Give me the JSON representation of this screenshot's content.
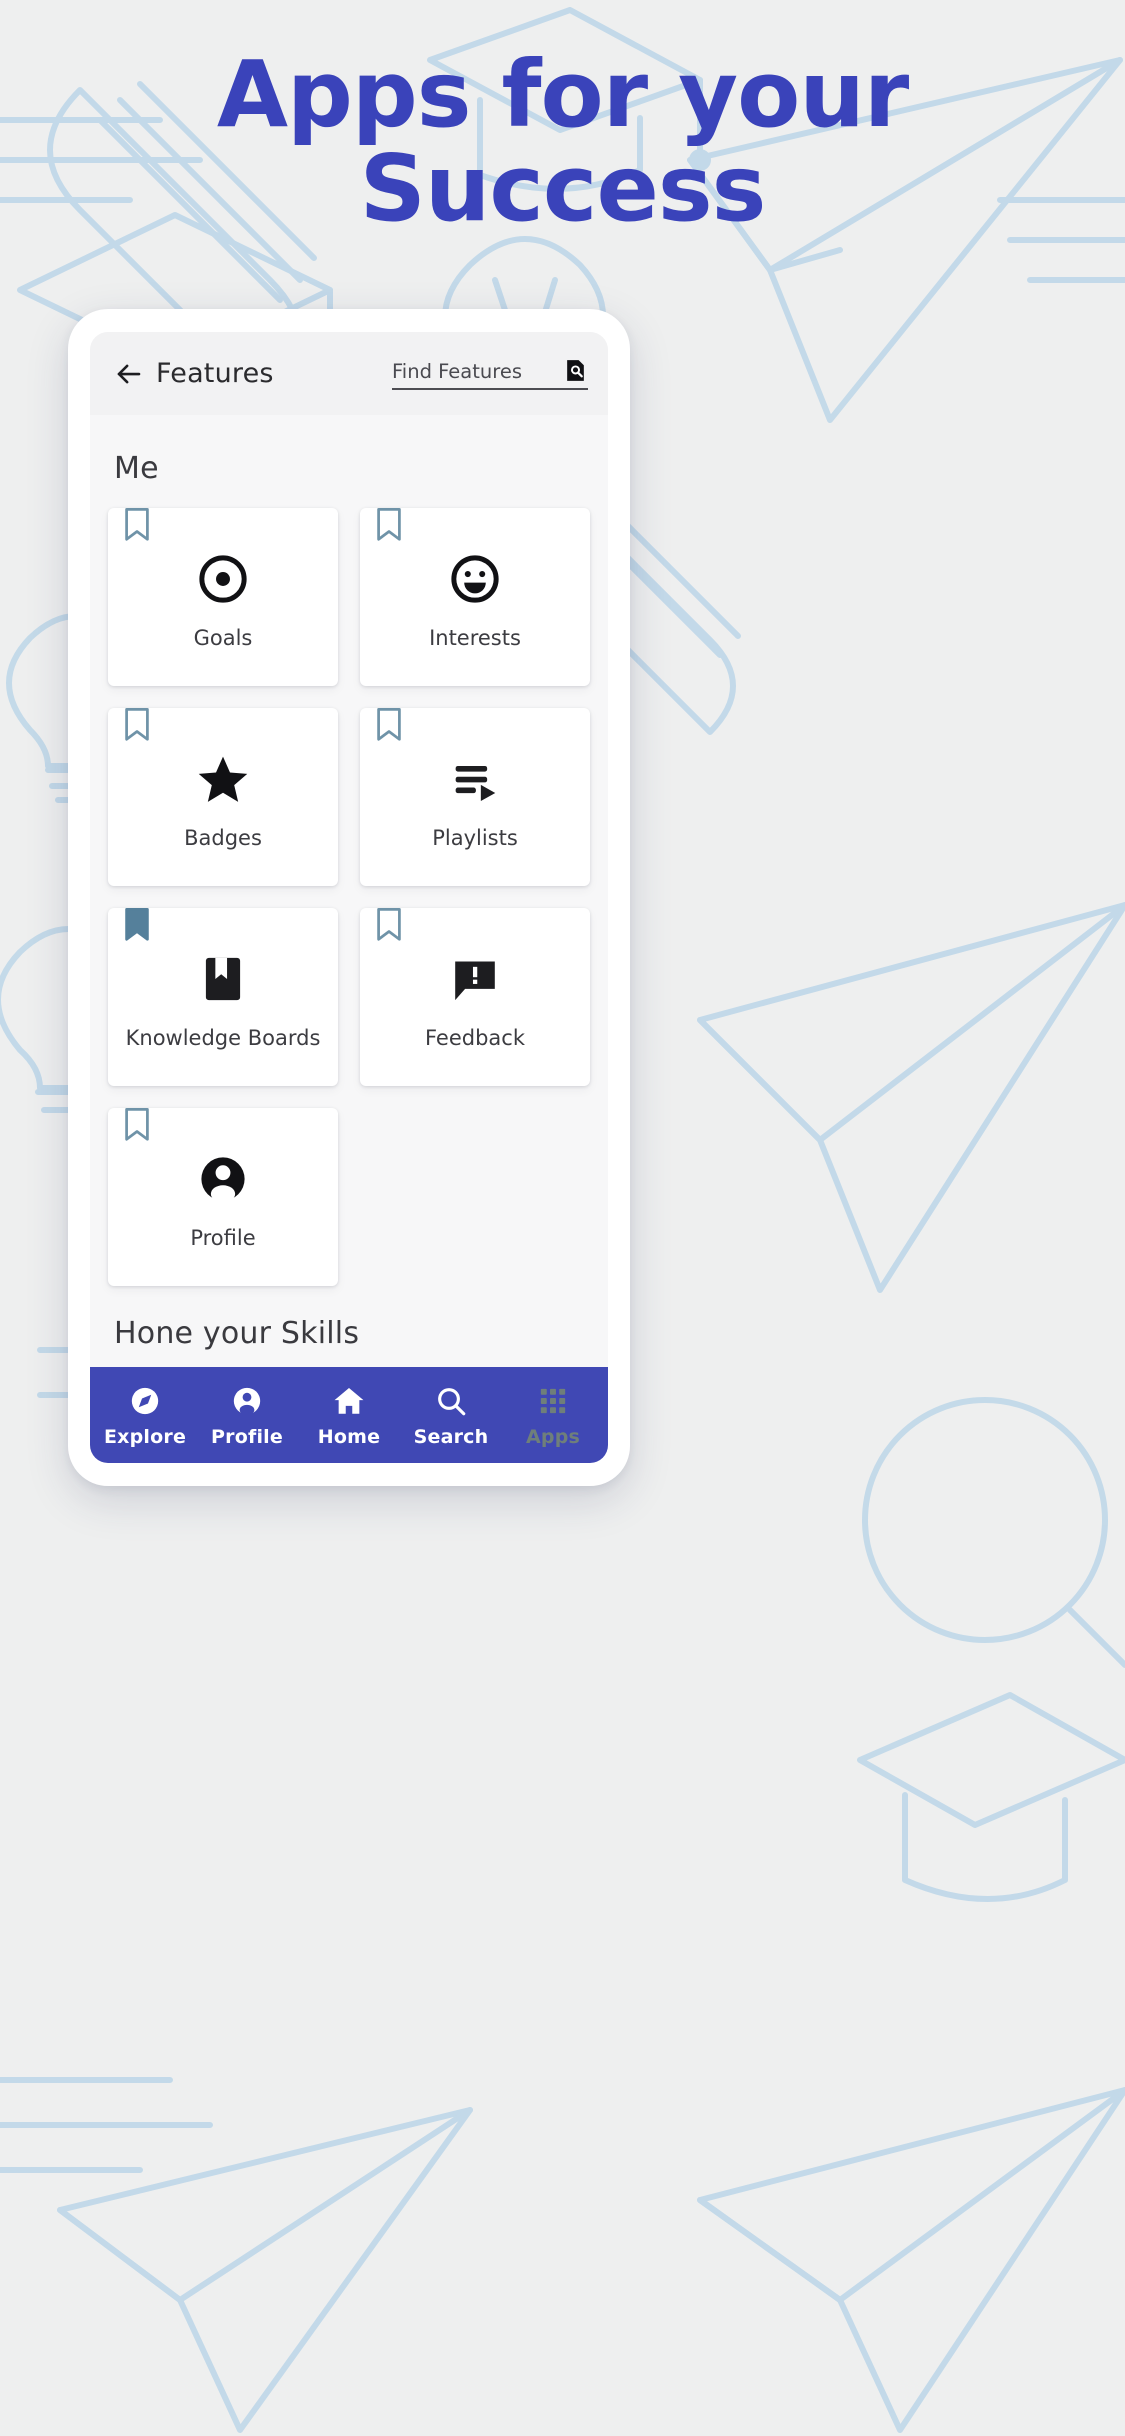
{
  "hero": {
    "line1": "Apps for your",
    "line2": "Success",
    "color": "#3a43ba"
  },
  "appbar": {
    "back_icon": "arrow-left-icon",
    "title": "Features",
    "search_placeholder": "Find Features",
    "search_icon": "search-document-icon"
  },
  "sections": [
    {
      "title": "Me"
    },
    {
      "title": "Hone your Skills"
    }
  ],
  "cards": [
    {
      "label": "Goals",
      "icon": "target-icon",
      "bookmarked": "outline"
    },
    {
      "label": "Interests",
      "icon": "smiley-face-icon",
      "bookmarked": "outline"
    },
    {
      "label": "Badges",
      "icon": "star-icon",
      "bookmarked": "outline"
    },
    {
      "label": "Playlists",
      "icon": "playlist-play-icon",
      "bookmarked": "outline"
    },
    {
      "label": "Knowledge Boards",
      "icon": "book-bookmark-icon",
      "bookmarked": "filled"
    },
    {
      "label": "Feedback",
      "icon": "comment-alert-icon",
      "bookmarked": "outline"
    },
    {
      "label": "Profile",
      "icon": "person-circle-icon",
      "bookmarked": "outline"
    }
  ],
  "bottom_nav": {
    "background": "#4048b4",
    "items": [
      {
        "label": "Explore",
        "icon": "compass-icon",
        "state": "active"
      },
      {
        "label": "Profile",
        "icon": "person-icon",
        "state": "active"
      },
      {
        "label": "Home",
        "icon": "home-icon",
        "state": "active"
      },
      {
        "label": "Search",
        "icon": "magnifier-icon",
        "state": "active"
      },
      {
        "label": "Apps",
        "icon": "grid-icon",
        "state": "muted"
      }
    ]
  }
}
